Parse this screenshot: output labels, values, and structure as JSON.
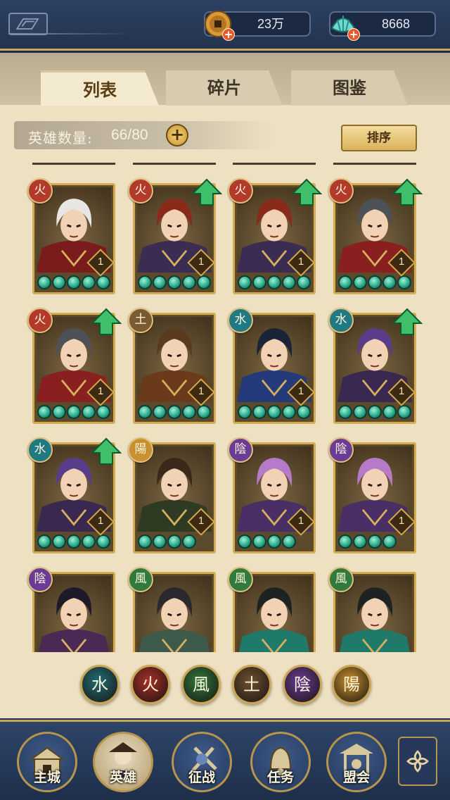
{
  "currencies": [
    {
      "name": "copper-coin",
      "amount": "23万",
      "color": "#c8902f"
    },
    {
      "name": "jade-shell",
      "amount": "8668",
      "color": "#5fd0c6"
    }
  ],
  "tabs": [
    {
      "label": "列表",
      "active": true
    },
    {
      "label": "碎片",
      "active": false
    },
    {
      "label": "图鉴",
      "active": false
    }
  ],
  "hero_count": {
    "label": "英雄数量:",
    "value": "66/80"
  },
  "sort_label": "排序",
  "heroes": [
    {
      "element": "火",
      "color": "#b23a2a",
      "level": "1",
      "beads": 5,
      "upgrade": false,
      "portrait": "white-hair"
    },
    {
      "element": "火",
      "color": "#b23a2a",
      "level": "1",
      "beads": 5,
      "upgrade": true,
      "portrait": "red-hair"
    },
    {
      "element": "火",
      "color": "#b23a2a",
      "level": "1",
      "beads": 5,
      "upgrade": true,
      "portrait": "red-hair"
    },
    {
      "element": "火",
      "color": "#b23a2a",
      "level": "1",
      "beads": 5,
      "upgrade": true,
      "portrait": "masked"
    },
    {
      "element": "火",
      "color": "#b23a2a",
      "level": "1",
      "beads": 5,
      "upgrade": true,
      "portrait": "masked"
    },
    {
      "element": "土",
      "color": "#7a5a33",
      "level": "1",
      "beads": 5,
      "upgrade": false,
      "portrait": "general"
    },
    {
      "element": "水",
      "color": "#1f7a82",
      "level": "1",
      "beads": 5,
      "upgrade": false,
      "portrait": "opera"
    },
    {
      "element": "水",
      "color": "#1f7a82",
      "level": "1",
      "beads": 5,
      "upgrade": true,
      "portrait": "purple-lady"
    },
    {
      "element": "水",
      "color": "#1f7a82",
      "level": "1",
      "beads": 5,
      "upgrade": true,
      "portrait": "purple-lady"
    },
    {
      "element": "陽",
      "color": "#c8902f",
      "level": "1",
      "beads": 4,
      "upgrade": false,
      "portrait": "scholar"
    },
    {
      "element": "陰",
      "color": "#6a3c95",
      "level": "1",
      "beads": 4,
      "upgrade": false,
      "portrait": "pink-hair"
    },
    {
      "element": "陰",
      "color": "#6a3c95",
      "level": "1",
      "beads": 4,
      "upgrade": false,
      "portrait": "pink-hair"
    },
    {
      "element": "陰",
      "color": "#6a3c95",
      "level": "",
      "beads": 0,
      "upgrade": false,
      "portrait": "dark-warrior"
    },
    {
      "element": "風",
      "color": "#2f7a3c",
      "level": "",
      "beads": 0,
      "upgrade": false,
      "portrait": "hat-man"
    },
    {
      "element": "風",
      "color": "#2f7a3c",
      "level": "",
      "beads": 0,
      "upgrade": false,
      "portrait": "green-swordsman"
    },
    {
      "element": "風",
      "color": "#2f7a3c",
      "level": "",
      "beads": 0,
      "upgrade": false,
      "portrait": "green-swordsman"
    }
  ],
  "element_filters": [
    {
      "label": "水",
      "color": "#1f6e78"
    },
    {
      "label": "火",
      "color": "#a8302a"
    },
    {
      "label": "風",
      "color": "#2f7a3c"
    },
    {
      "label": "土",
      "color": "#6e5030"
    },
    {
      "label": "陰",
      "color": "#6a3c95"
    },
    {
      "label": "陽",
      "color": "#c8902f"
    }
  ],
  "nav": [
    {
      "label": "主城",
      "icon": "city-gate-icon",
      "active": false
    },
    {
      "label": "英雄",
      "icon": "hero-icon",
      "active": true
    },
    {
      "label": "征战",
      "icon": "campaign-icon",
      "active": false
    },
    {
      "label": "任务",
      "icon": "quest-bell-icon",
      "active": false
    },
    {
      "label": "盟会",
      "icon": "alliance-pavilion-icon",
      "active": false
    }
  ]
}
